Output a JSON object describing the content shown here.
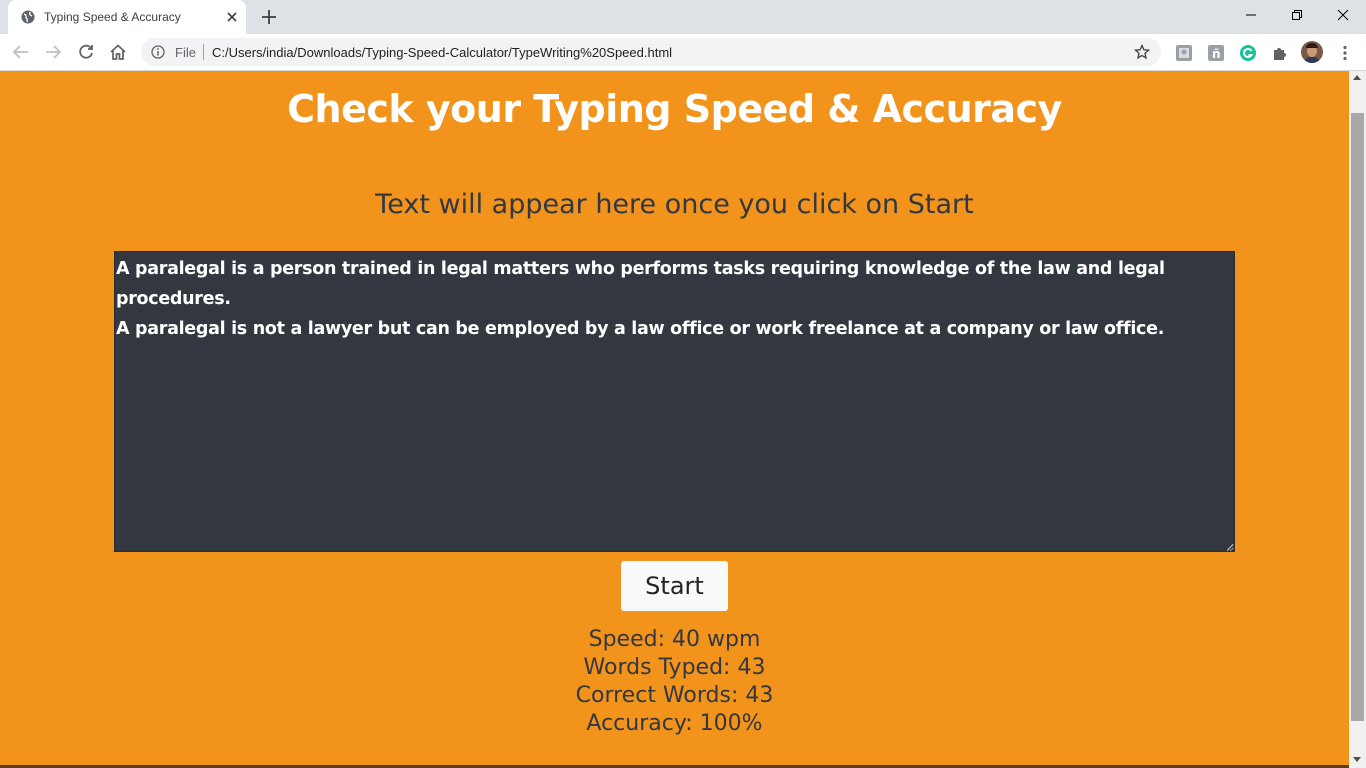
{
  "browser": {
    "tab_title": "Typing Speed & Accuracy",
    "omnibox_scheme_label": "File",
    "url": "C:/Users/india/Downloads/Typing-Speed-Calculator/TypeWriting%20Speed.html",
    "icons": {
      "back": "arrow-left-icon",
      "forward": "arrow-right-icon",
      "reload": "reload-icon",
      "home": "home-icon",
      "info": "info-icon",
      "bookmark": "star-icon",
      "extensions": [
        "extension-1-icon",
        "extension-2-icon",
        "grammarly-icon",
        "puzzle-icon"
      ],
      "profile": "avatar",
      "menu": "kebab-menu-icon"
    }
  },
  "page": {
    "title": "Check your Typing Speed & Accuracy",
    "prompt": "Text will appear here once you click on Start",
    "typed_text": "A paralegal is a person trained in legal matters who performs tasks requiring knowledge of the law and legal procedures.\nA paralegal is not a lawyer but can be employed by a law office or work freelance at a company or law office.",
    "start_label": "Start",
    "stats": {
      "speed": "Speed: 40 wpm",
      "words_typed": "Words Typed: 43",
      "correct_words": "Correct Words: 43",
      "accuracy": "Accuracy: 100%"
    }
  },
  "colors": {
    "page_background": "#f2931c",
    "text_area_background": "#333840",
    "title_color": "#ffffff",
    "button_background": "#f8f9fa"
  }
}
